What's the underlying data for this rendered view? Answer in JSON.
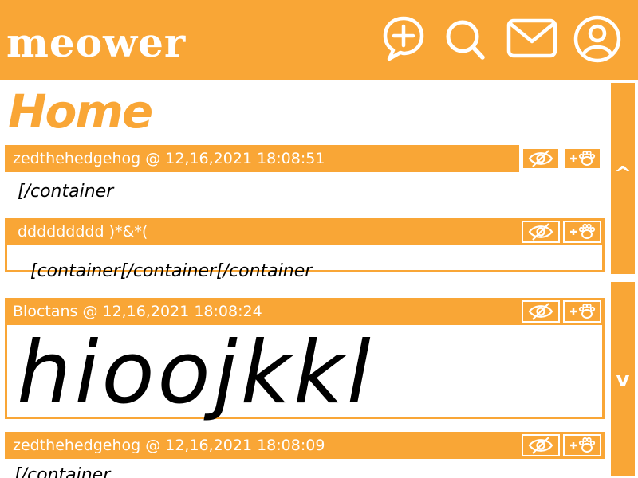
{
  "app": {
    "logo": "meower"
  },
  "topbar": {
    "icons": [
      "new-post-icon",
      "search-icon",
      "mail-icon",
      "profile-icon"
    ],
    "accent": "#F9A636"
  },
  "page": {
    "title": "Home"
  },
  "posts": [
    {
      "meta": "zedthehedgehog @ 12,16,2021 18:08:51",
      "text": "[/container"
    },
    {
      "meta": "ddddddddd )*&*(",
      "text": "[container[/container[/container"
    },
    {
      "meta": "Bloctans @ 12,16,2021 18:08:24",
      "text": "hioojkkl"
    },
    {
      "meta": "zedthehedgehog @ 12,16,2021 18:08:09",
      "text": "[/container"
    }
  ],
  "post_actions": {
    "hide_icon": "eye-slash-icon",
    "pet_icon": "add-paw-icon"
  },
  "scroll": {
    "up_label": "^",
    "down_label": "v"
  }
}
